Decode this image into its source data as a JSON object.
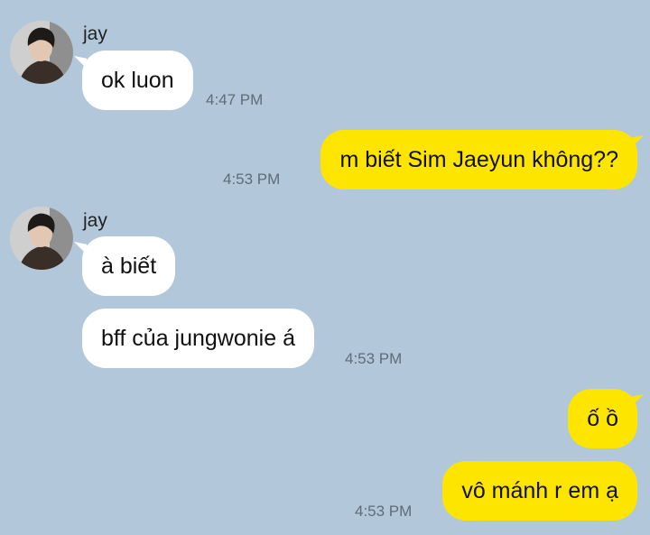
{
  "sender_name": "jay",
  "messages": [
    {
      "text": "ok luon",
      "time": "4:47 PM"
    },
    {
      "text": "m biết Sim Jaeyun không??",
      "time": "4:53 PM"
    },
    {
      "text": "à biết"
    },
    {
      "text": "bff của jungwonie á",
      "time": "4:53 PM"
    },
    {
      "text": "ố ồ"
    },
    {
      "text": "vô mánh r em ạ",
      "time": "4:53 PM"
    }
  ],
  "colors": {
    "background": "#b2c7d9",
    "incoming_bubble": "#ffffff",
    "outgoing_bubble": "#fee500",
    "timestamp": "#5d6d7a"
  },
  "icons": {
    "avatar": "profile-photo"
  }
}
